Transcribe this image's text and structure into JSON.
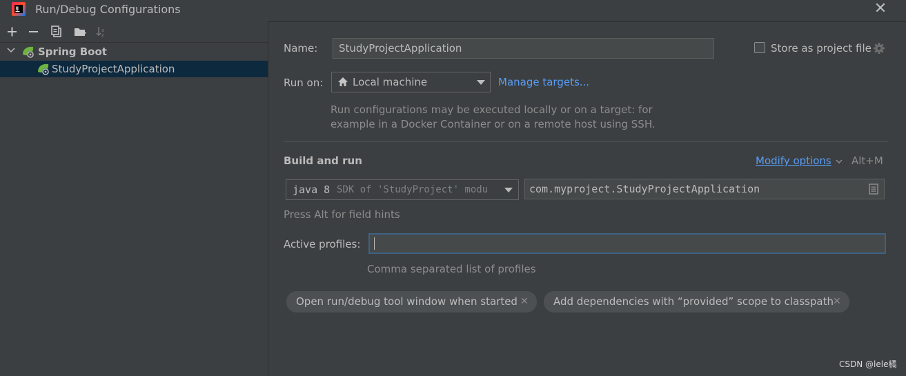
{
  "window": {
    "title": "Run/Debug Configurations",
    "close_glyph": "✕"
  },
  "toolbar": {
    "add": "+",
    "remove": "−"
  },
  "tree": {
    "root_label": "Spring Boot",
    "child_label": "StudyProjectApplication"
  },
  "form": {
    "name_label": "Name:",
    "name_value": "StudyProjectApplication",
    "store_label": "Store as project file",
    "run_on_label": "Run on:",
    "run_on_value": "Local machine",
    "manage_targets": "Manage targets...",
    "run_on_hint_1": "Run configurations may be executed locally or on a target: for",
    "run_on_hint_2": "example in a Docker Container or on a remote host using SSH.",
    "build_and_run": "Build and run",
    "modify_options": "Modify options",
    "modify_shortcut": "Alt+M",
    "jdk_value": "java 8",
    "jdk_hint": "SDK of 'StudyProject' modu",
    "main_class": "com.myproject.StudyProjectApplication",
    "field_hints": "Press Alt for field hints",
    "active_profiles_label": "Active profiles:",
    "active_profiles_value": "",
    "active_profiles_hint": "Comma separated list of profiles"
  },
  "options": [
    {
      "label": "Open run/debug tool window when started",
      "remove": "✕"
    },
    {
      "label": "Add dependencies with “provided” scope to classpath",
      "remove": "✕"
    }
  ],
  "watermark": "CSDN @lele橘",
  "colors": {
    "background": "#3c3f41",
    "selection": "#0d293e",
    "link": "#589df6",
    "focus_border": "#3d6185",
    "spring_green": "#6db33f"
  }
}
